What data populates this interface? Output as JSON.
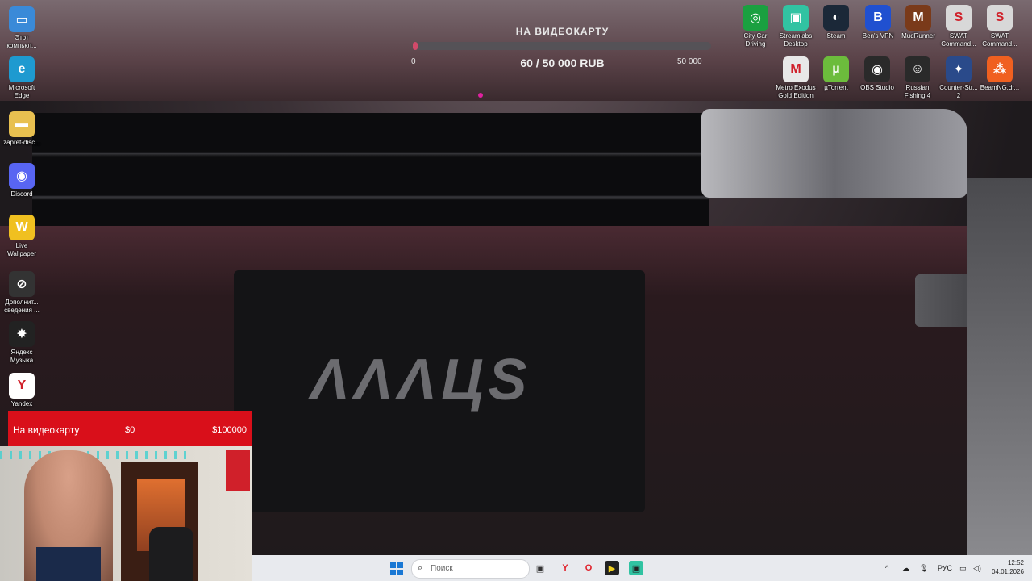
{
  "desktop_left": [
    {
      "name": "this-pc-icon",
      "label": "Этот компьют...",
      "color": "#3a8ad8",
      "glyph": "▭"
    },
    {
      "name": "edge-icon",
      "label": "Microsoft Edge",
      "color": "#1e9ad0",
      "glyph": "e"
    },
    {
      "name": "folder-icon",
      "label": "zapret-disc...",
      "color": "#e8c050",
      "glyph": "▬"
    },
    {
      "name": "discord-icon",
      "label": "Discord",
      "color": "#5865f2",
      "glyph": "◉"
    },
    {
      "name": "live-wallpaper-icon",
      "label": "Live Wallpaper",
      "color": "#f0c020",
      "glyph": "W"
    },
    {
      "name": "extra-info-icon",
      "label": "Дополнит... сведения ...",
      "color": "#333",
      "glyph": "⊘"
    },
    {
      "name": "yandex-music-icon",
      "label": "Яндекс Музыка",
      "color": "#222",
      "glyph": "✸"
    },
    {
      "name": "yandex-icon",
      "label": "Yandex",
      "color": "#fff",
      "glyph": "Y"
    }
  ],
  "desktop_right_row1": [
    {
      "name": "city-car-driving-icon",
      "label": "City Car Driving",
      "color": "#1aa040",
      "glyph": "◎"
    },
    {
      "name": "streamlabs-icon",
      "label": "Streamlabs Desktop",
      "color": "#31c3a2",
      "glyph": "▣"
    },
    {
      "name": "steam-icon",
      "label": "Steam",
      "color": "#1b2838",
      "glyph": "◐"
    },
    {
      "name": "bens-vpn-icon",
      "label": "Ben's VPN",
      "color": "#2050d0",
      "glyph": "B"
    },
    {
      "name": "mudrunner-icon",
      "label": "MudRunner",
      "color": "#7a3a1a",
      "glyph": "M"
    },
    {
      "name": "swat-icon-1",
      "label": "SWAT Command...",
      "color": "#d8d8d8",
      "glyph": "S"
    },
    {
      "name": "swat-icon-2",
      "label": "SWAT Command...",
      "color": "#d8d8d8",
      "glyph": "S"
    }
  ],
  "desktop_right_row2": [
    {
      "name": "metro-exodus-icon",
      "label": "Metro Exodus Gold Edition",
      "color": "#e8e8e8",
      "glyph": "M"
    },
    {
      "name": "utorrent-icon",
      "label": "µTorrent",
      "color": "#6cbc3c",
      "glyph": "µ"
    },
    {
      "name": "obs-icon",
      "label": "OBS Studio",
      "color": "#2a2a2a",
      "glyph": "◉"
    },
    {
      "name": "russian-fishing-icon",
      "label": "Russian Fishing 4",
      "color": "#2a2a2a",
      "glyph": "☺"
    },
    {
      "name": "counter-strike-icon",
      "label": "Counter-Str... 2",
      "color": "#2a4a8a",
      "glyph": "✦"
    },
    {
      "name": "beamng-icon",
      "label": "BeamNG.dr...",
      "color": "#f06020",
      "glyph": "⁂"
    }
  ],
  "goal": {
    "title": "НА ВИДЕОКАРТУ",
    "min": "0",
    "max": "50 000",
    "amount": "60 / 50 000 RUB",
    "fraction": 0.0012,
    "fill_color": "#d14a6a"
  },
  "plate_text": "ΛΛΛЦS",
  "donation_bar": {
    "label": "На видеокарту",
    "current": "$0",
    "target": "$100000",
    "color": "#d90f1a"
  },
  "taskbar": {
    "search_placeholder": "Поиск",
    "apps": [
      {
        "name": "task-view-icon",
        "glyph": "▣",
        "color": "#333",
        "bg": "transparent"
      },
      {
        "name": "yandex-browser-icon",
        "glyph": "Y",
        "color": "#e0202a",
        "bg": "transparent"
      },
      {
        "name": "opera-icon",
        "glyph": "O",
        "color": "#e0202a",
        "bg": "transparent"
      },
      {
        "name": "terminal-app-icon",
        "glyph": "▶",
        "color": "#f0d020",
        "bg": "#222"
      },
      {
        "name": "streamlabs-taskbar-icon",
        "glyph": "▣",
        "color": "#222",
        "bg": "#31c3a2"
      }
    ],
    "tray": {
      "chevron": "^",
      "lang": "РУС",
      "time": "12:52",
      "date": "04.01.2026"
    }
  }
}
